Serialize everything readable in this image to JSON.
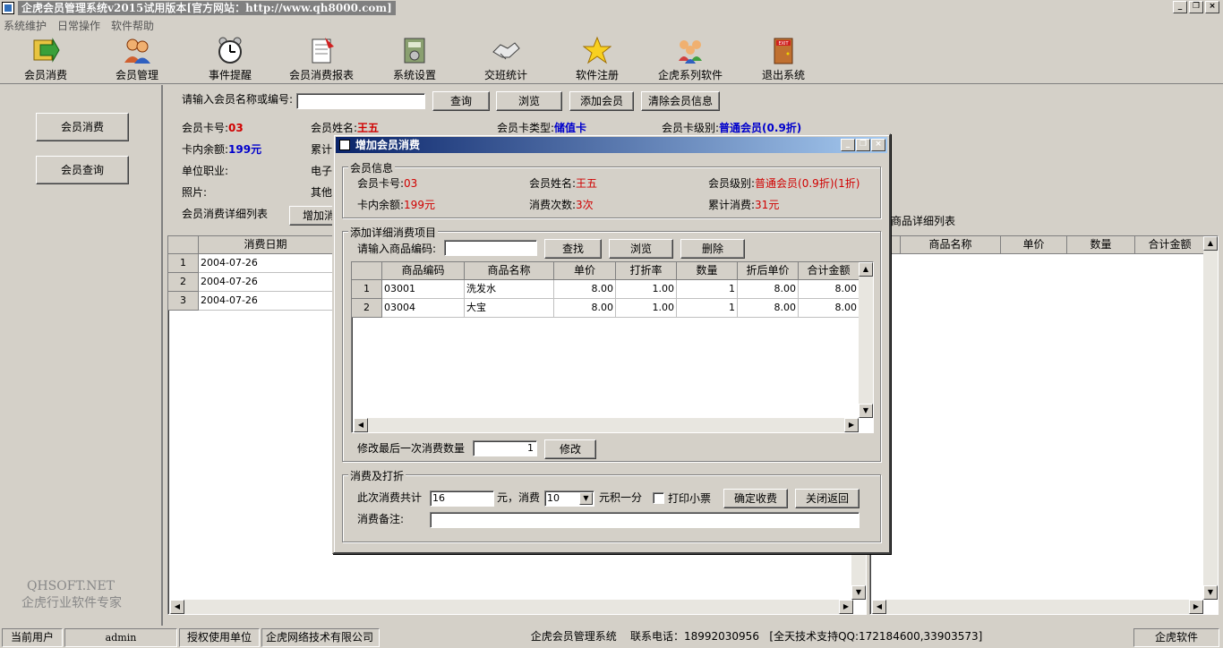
{
  "window": {
    "title": "企虎会员管理系统v2015试用版本[官方网站：http://www.qh8000.com]",
    "min": "_",
    "max": "❐",
    "close": "×"
  },
  "menu": [
    "系统维护",
    "日常操作",
    "软件帮助"
  ],
  "toolbar": [
    {
      "label": "会员消费",
      "icon": "arrow-icon"
    },
    {
      "label": "会员管理",
      "icon": "users-icon"
    },
    {
      "label": "事件提醒",
      "icon": "alarm-clock-icon"
    },
    {
      "label": "会员消费报表",
      "icon": "report-icon"
    },
    {
      "label": "系统设置",
      "icon": "settings-icon"
    },
    {
      "label": "交班统计",
      "icon": "handshake-icon"
    },
    {
      "label": "软件注册",
      "icon": "star-icon"
    },
    {
      "label": "企虎系列软件",
      "icon": "group-icon"
    },
    {
      "label": "退出系统",
      "icon": "exit-door-icon"
    }
  ],
  "left": {
    "btn_consume": "会员消费",
    "btn_query": "会员查询",
    "brand_line1": "QHSOFT.NET",
    "brand_line2": "企虎行业软件专家"
  },
  "search": {
    "label": "请输入会员名称或编号:",
    "value": "",
    "btn_query": "查询",
    "btn_browse": "浏览",
    "btn_add": "添加会员",
    "btn_clear": "清除会员信息"
  },
  "member": {
    "card_no_label": "会员卡号:",
    "card_no": "03",
    "name_label": "会员姓名:",
    "name": "王五",
    "card_type_label": "会员卡类型:",
    "card_type": "储值卡",
    "card_level_label": "会员卡级别:",
    "card_level": "普通会员(0.9折)",
    "balance_label": "卡内余额:",
    "balance": "199元",
    "total_label_partial": "累计",
    "job_label": "单位职业:",
    "email_partial": "电子",
    "photo_label": "照片:",
    "other_partial": "其他",
    "detail_list_label": "会员消费详细列表",
    "add_btn_partial": "增加消",
    "goods_list_label": "商品详细列表"
  },
  "left_grid": {
    "headers": [
      "消费日期"
    ],
    "rows": [
      {
        "n": "1",
        "date": "2004-07-26"
      },
      {
        "n": "2",
        "date": "2004-07-26"
      },
      {
        "n": "3",
        "date": "2004-07-26"
      }
    ]
  },
  "right_grid": {
    "headers": [
      "商品名称",
      "单价",
      "数量",
      "合计金额"
    ]
  },
  "dialog": {
    "title": "增加会员消费",
    "info_legend": "会员信息",
    "card_no_label": "会员卡号:",
    "card_no": "03",
    "name_label": "会员姓名:",
    "name": "王五",
    "level_label": "会员级别:",
    "level": "普通会员(0.9折)(1折)",
    "balance_label": "卡内余额:",
    "balance": "199元",
    "count_label": "消费次数:",
    "count": "3次",
    "total_label": "累计消费:",
    "total": "31元",
    "detail_legend": "添加详细消费项目",
    "goods_code_label": "请输入商品编码:",
    "goods_code_value": "",
    "btn_find": "查找",
    "btn_browse": "浏览",
    "btn_delete": "删除",
    "grid_headers": [
      "商品编码",
      "商品名称",
      "单价",
      "打折率",
      "数量",
      "折后单价",
      "合计金额"
    ],
    "grid_rows": [
      {
        "n": "1",
        "code": "03001",
        "name": "洗发水",
        "price": "8.00",
        "rate": "1.00",
        "qty": "1",
        "dprice": "8.00",
        "total": "8.00"
      },
      {
        "n": "2",
        "code": "03004",
        "name": "大宝",
        "price": "8.00",
        "rate": "1.00",
        "qty": "1",
        "dprice": "8.00",
        "total": "8.00"
      }
    ],
    "modify_label": "修改最后一次消费数量",
    "modify_value": "1",
    "btn_modify": "修改",
    "pay_legend": "消费及打折",
    "sum_label": "此次消费共计",
    "sum_value": "16",
    "yuan_consume": "元，消费",
    "rate_value": "10",
    "points_label": "元积一分",
    "print_label": "打印小票",
    "btn_confirm": "确定收费",
    "btn_close": "关闭返回",
    "remark_label": "消费备注:",
    "remark_value": ""
  },
  "status": {
    "user_label": "当前用户",
    "user": "admin",
    "auth_label": "授权使用单位",
    "company": "企虎网络技术有限公司",
    "app": "企虎会员管理系统",
    "phone": "联系电话：18992030956",
    "support": "[全天技术支持QQ:172184600,33903573]",
    "brand": "企虎软件"
  }
}
